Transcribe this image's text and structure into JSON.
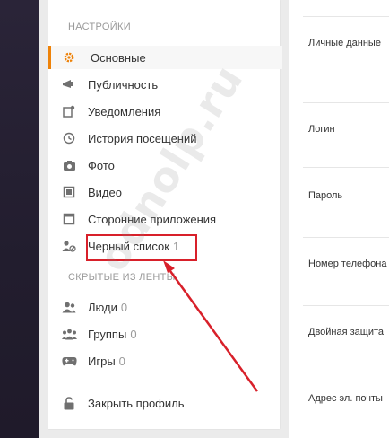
{
  "settings_header": "НАСТРОЙКИ",
  "hidden_header": "СКРЫТЫЕ ИЗ ЛЕНТЫ",
  "menu": [
    {
      "label": "Основные",
      "icon": "gear-icon",
      "count": "",
      "active": true
    },
    {
      "label": "Публичность",
      "icon": "megaphone-icon",
      "count": ""
    },
    {
      "label": "Уведомления",
      "icon": "notification-icon",
      "count": ""
    },
    {
      "label": "История посещений",
      "icon": "history-icon",
      "count": ""
    },
    {
      "label": "Фото",
      "icon": "camera-icon",
      "count": ""
    },
    {
      "label": "Видео",
      "icon": "video-icon",
      "count": ""
    },
    {
      "label": "Сторонние приложения",
      "icon": "app-window-icon",
      "count": ""
    },
    {
      "label": "Черный список",
      "icon": "blocked-user-icon",
      "count": "1"
    }
  ],
  "hidden": [
    {
      "label": "Люди",
      "icon": "people-icon",
      "count": "0"
    },
    {
      "label": "Группы",
      "icon": "groups-icon",
      "count": "0"
    },
    {
      "label": "Игры",
      "icon": "gamepad-icon",
      "count": "0"
    }
  ],
  "close_profile": {
    "label": "Закрыть профиль",
    "icon": "lock-open-icon"
  },
  "main_rows": [
    "Личные данные",
    "Логин",
    "Пароль",
    "Номер телефона",
    "Двойная защита",
    "Адрес эл. почты"
  ],
  "watermark": "odnolp.ru",
  "colors": {
    "accent": "#ee8208",
    "highlight": "#d8202a",
    "dark": "#2a2438"
  }
}
